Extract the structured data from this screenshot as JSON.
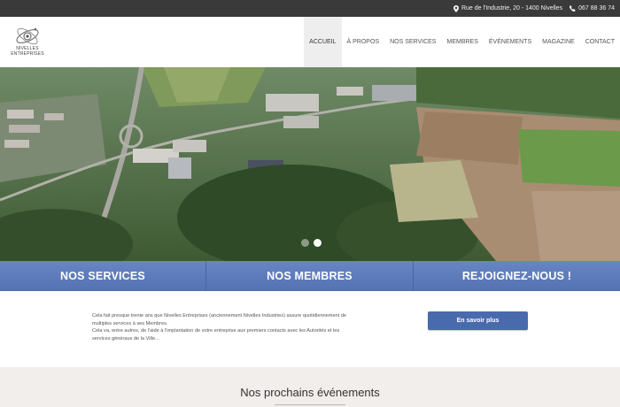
{
  "topbar": {
    "address": "Rue de l'Industrie, 20 - 1400 Nivelles",
    "phone": "067 88 36 74",
    "address_icon": "map-pin-icon",
    "phone_icon": "phone-icon"
  },
  "logo": {
    "line1": "NIVELLES",
    "line2": "ENTREPRISES"
  },
  "nav": {
    "items": [
      {
        "label": "ACCUEIL",
        "active": true
      },
      {
        "label": "À PROPOS"
      },
      {
        "label": "NOS SERVICES"
      },
      {
        "label": "MEMBRES"
      },
      {
        "label": "ÉVÉNEMENTS"
      },
      {
        "label": "MAGAZINE"
      },
      {
        "label": "CONTACT"
      }
    ]
  },
  "slider": {
    "slide_count": 2,
    "active_index": 1
  },
  "cta": {
    "services": "NOS SERVICES",
    "members": "NOS MEMBRES",
    "join": "REJOIGNEZ-NOUS !"
  },
  "intro": {
    "line1": "Cela fait presque trente ans que Nivelles Entreprises (anciennement Nivelles Industries) assure quotidiennement de",
    "line2": "multiples services à ses Membres.",
    "line3": "Cela va, entre autres, de l'aide à l'implantation de votre entreprise aux premiers contacts avec les Autorités et les",
    "line4": "services généraux de la Ville...",
    "button": "En savoir plus"
  },
  "events": {
    "title": "Nos prochains événements"
  },
  "colors": {
    "topbar": "#3a3a3a",
    "cta_blue": "#5b79b7",
    "button_blue": "#4a6aae",
    "events_bg": "#f1eeeb"
  }
}
